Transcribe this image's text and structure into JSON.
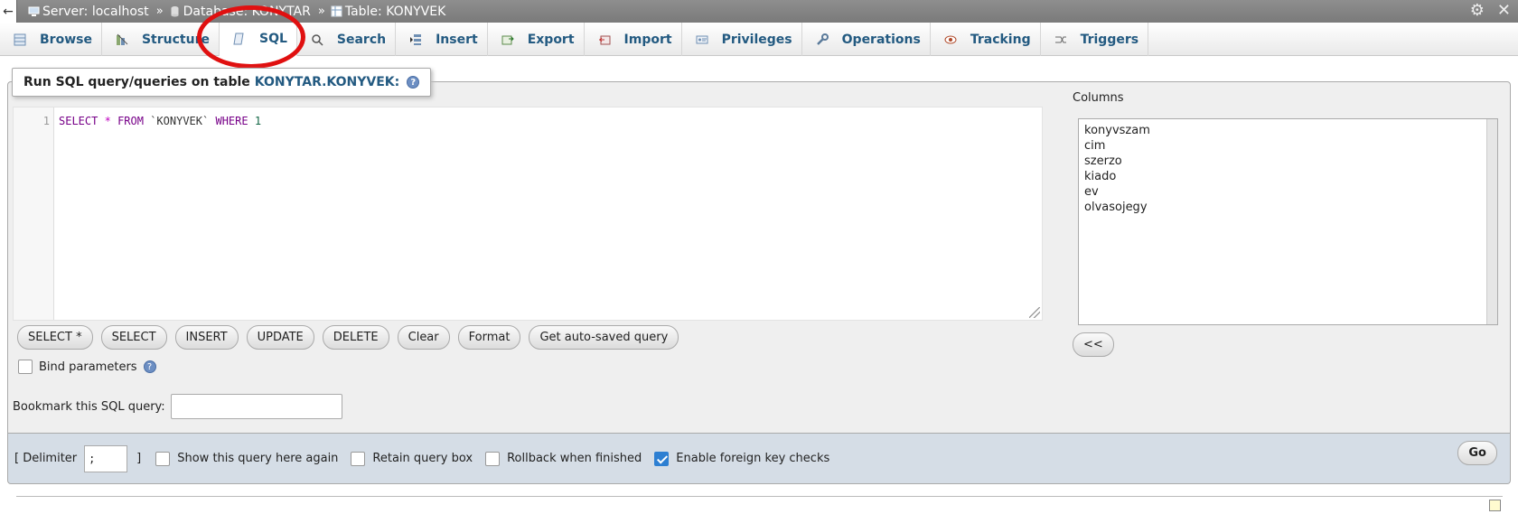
{
  "breadcrumb": {
    "server": "Server: localhost",
    "database": "Database: KONYTAR",
    "table": "Table: KONYVEK"
  },
  "tabs": [
    {
      "label": "Browse",
      "icon": "browse-icon"
    },
    {
      "label": "Structure",
      "icon": "structure-icon"
    },
    {
      "label": "SQL",
      "icon": "sql-icon",
      "active": true
    },
    {
      "label": "Search",
      "icon": "search-icon"
    },
    {
      "label": "Insert",
      "icon": "insert-icon"
    },
    {
      "label": "Export",
      "icon": "export-icon"
    },
    {
      "label": "Import",
      "icon": "import-icon"
    },
    {
      "label": "Privileges",
      "icon": "privileges-icon"
    },
    {
      "label": "Operations",
      "icon": "operations-icon"
    },
    {
      "label": "Tracking",
      "icon": "tracking-icon"
    },
    {
      "label": "Triggers",
      "icon": "triggers-icon"
    }
  ],
  "query_panel": {
    "legend_prefix": "Run SQL query/queries on table",
    "legend_table": "KONYTAR.KONYVEK:",
    "line_number": "1",
    "query_parts": {
      "select": "SELECT",
      "star": "*",
      "from": "FROM",
      "table": "`KONYVEK`",
      "where": "WHERE",
      "one": "1"
    }
  },
  "buttons": {
    "select_star": "SELECT *",
    "select": "SELECT",
    "insert": "INSERT",
    "update": "UPDATE",
    "delete": "DELETE",
    "clear": "Clear",
    "format": "Format",
    "auto_saved": "Get auto-saved query",
    "insert_column": "<<",
    "go": "Go"
  },
  "bind_parameters": "Bind parameters",
  "bookmark_label": "Bookmark this SQL query:",
  "columns": {
    "heading": "Columns",
    "items": [
      "konyvszam",
      "cim",
      "szerzo",
      "kiado",
      "ev",
      "olvasojegy"
    ]
  },
  "footer": {
    "delimiter_open": "[ Delimiter",
    "delimiter_value": ";",
    "delimiter_close": "]",
    "show_query": "Show this query here again",
    "retain_box": "Retain query box",
    "rollback": "Rollback when finished",
    "foreign_keys": "Enable foreign key checks"
  },
  "colors": {
    "accent": "#235a81",
    "highlight_circle": "#e01010"
  }
}
